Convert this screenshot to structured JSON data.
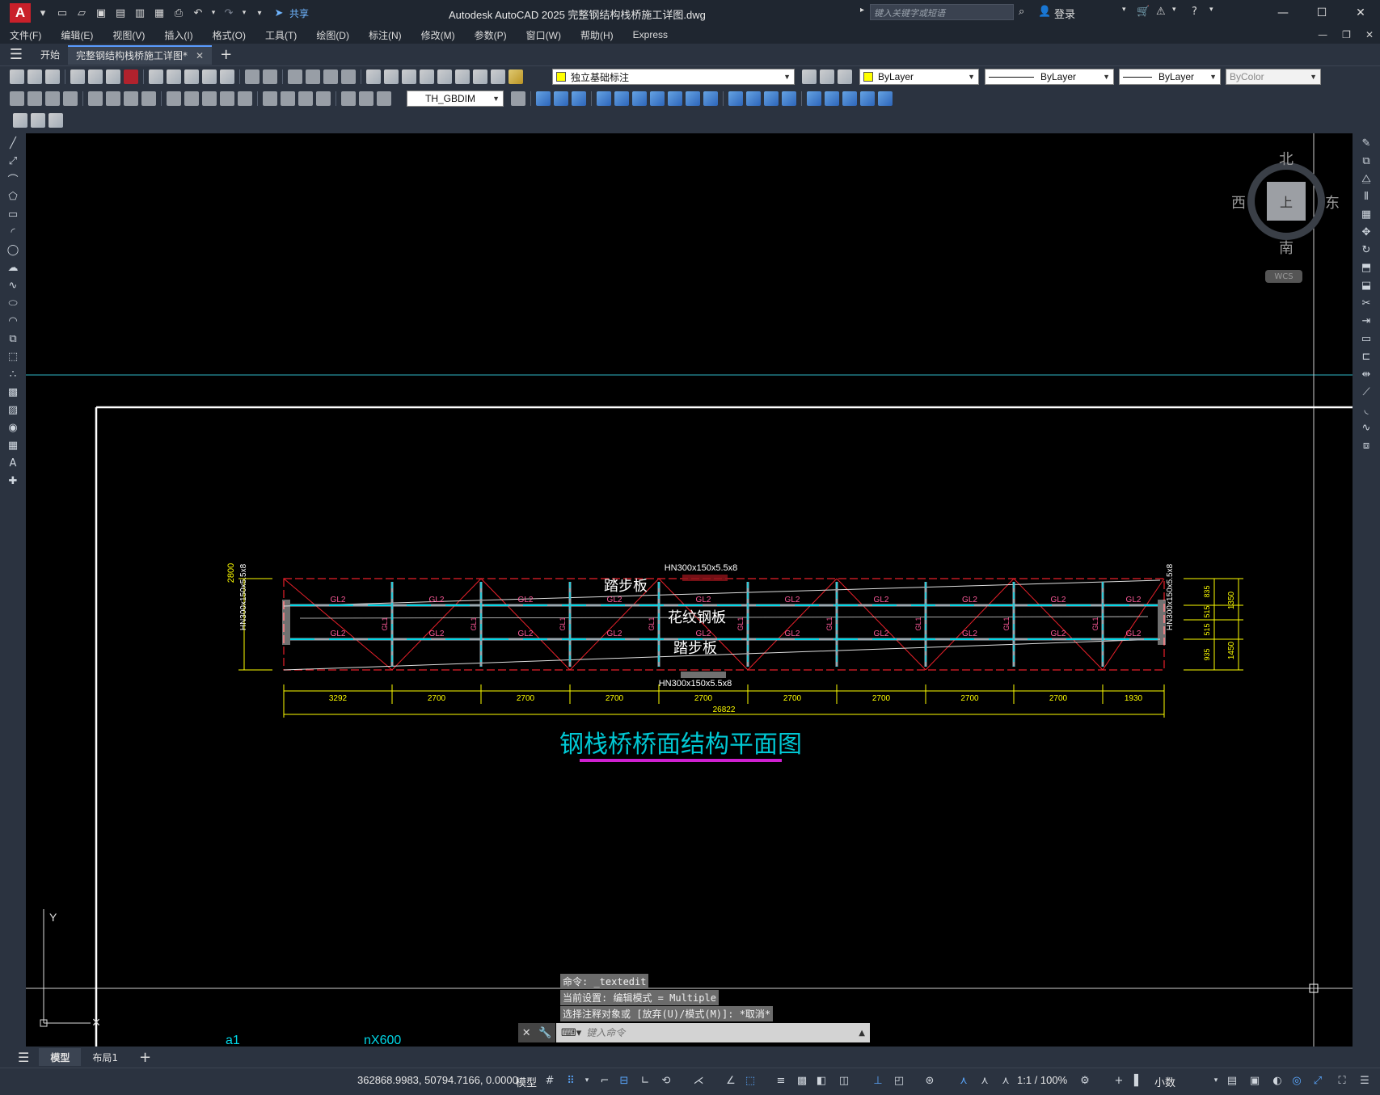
{
  "titlebar": {
    "logo": "A",
    "share": "共享",
    "title": "Autodesk AutoCAD 2025    完整钢结构栈桥施工详图.dwg",
    "search_placeholder": "键入关键字或短语",
    "login": "登录"
  },
  "menu": [
    "文件(F)",
    "编辑(E)",
    "视图(V)",
    "插入(I)",
    "格式(O)",
    "工具(T)",
    "绘图(D)",
    "标注(N)",
    "修改(M)",
    "参数(P)",
    "窗口(W)",
    "帮助(H)",
    "Express"
  ],
  "tabs": [
    {
      "label": "开始"
    },
    {
      "label": "完整钢结构栈桥施工详图*"
    }
  ],
  "toolbar": {
    "layer": "独立基础标注",
    "color": "ByLayer",
    "linetype": "ByLayer",
    "lineweight": "ByLayer",
    "plotstyle": "ByColor",
    "dimstyle": "TH_GBDIM"
  },
  "viewcube": {
    "north": "北",
    "south": "南",
    "east": "东",
    "west": "西",
    "face": "上",
    "wcs": "WCS"
  },
  "drawing": {
    "beam_top": "HN300x150x5.5x8",
    "beam_bottom": "HN300x150x5.5x8",
    "beam_left": "HN300x150x5.5x8",
    "beam_right": "HN300x150x5.5x8",
    "label_top": "踏步板",
    "label_mid": "花纹钢板",
    "label_bottom": "踏步板",
    "gl2": "GL2",
    "gl1": "GL1",
    "left_dim": "2800",
    "right_dims": [
      "835",
      "515",
      "515",
      "935"
    ],
    "right_dims2": [
      "1350",
      "1450"
    ],
    "bottom_dims": [
      "3292",
      "2700",
      "2700",
      "2700",
      "2700",
      "2700",
      "2700",
      "2700",
      "2700",
      "1930"
    ],
    "total_dim": "26822",
    "title": "钢栈桥桥面结构平面图",
    "axis_y": "Y",
    "bottom_label_a": "a1",
    "bottom_label_b": "nX600"
  },
  "command": {
    "line1": "命令: _textedit",
    "line2": "当前设置: 编辑模式 = Multiple",
    "line3": "选择注释对象或 [放弃(U)/模式(M)]: *取消*",
    "placeholder": "键入命令"
  },
  "layout_tabs": [
    "模型",
    "布局1"
  ],
  "status": {
    "coords": "362868.9983, 50794.7166, 0.0000",
    "mode": "模型",
    "scale": "1:1 / 100%",
    "units": "小数"
  },
  "colors": {
    "beam_red": "#e8202a",
    "cyan": "#00d8e8",
    "yellow": "#ffff00",
    "white": "#ffffff",
    "title_cyan": "#00c8d4",
    "underline": "#d020d0"
  }
}
